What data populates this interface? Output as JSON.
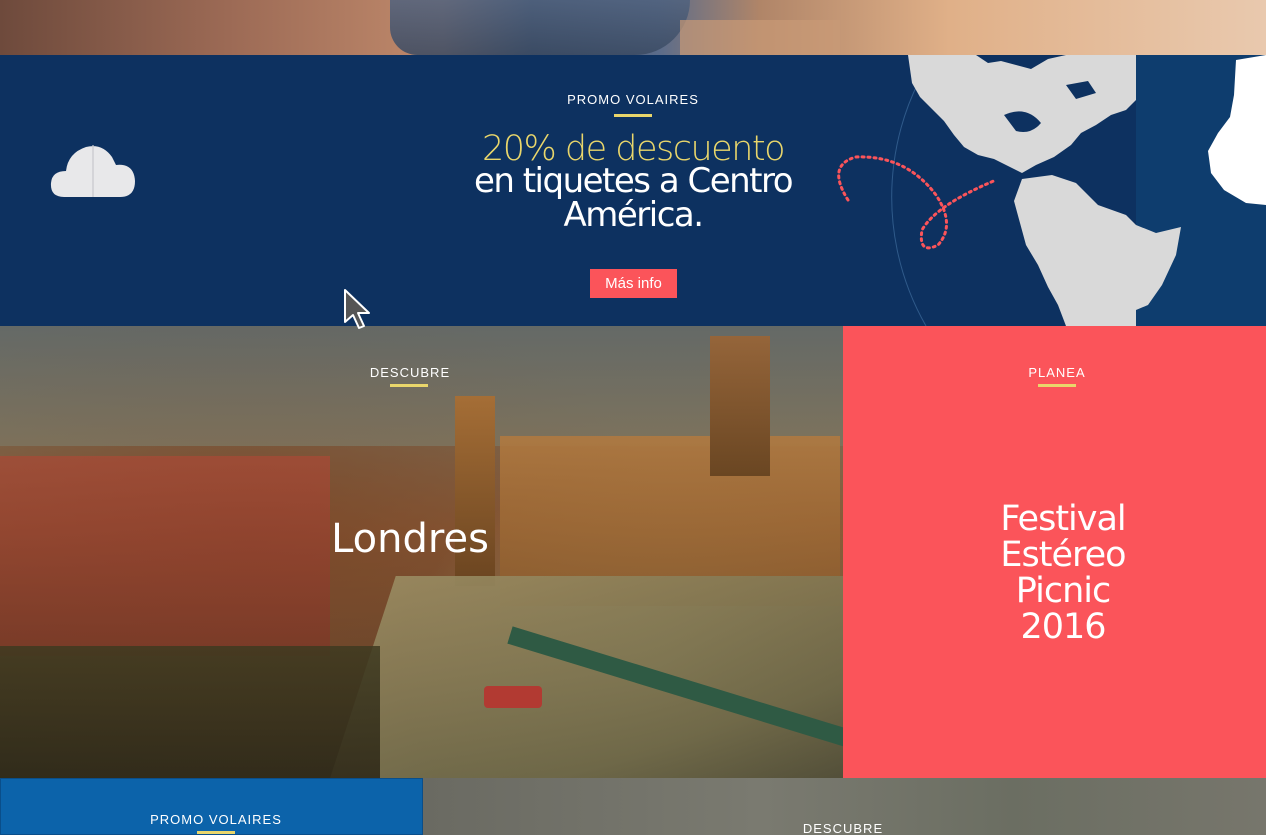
{
  "promo_banner": {
    "eyebrow": "PROMO VOLAIRES",
    "headline_highlight": "20% de descuento",
    "headline_line1": "en tiquetes a Centro",
    "headline_line2": "América.",
    "cta_label": "Más info",
    "icons": [
      "cloud-icon",
      "globe-map-icon"
    ],
    "colors": {
      "background": "#0d3160",
      "accent": "#e9d66b",
      "button": "#fb545a"
    }
  },
  "london_card": {
    "eyebrow": "DESCUBRE",
    "title": "Londres"
  },
  "festival_card": {
    "eyebrow": "PLANEA",
    "title_lines": [
      "Festival",
      "Estéreo",
      "Picnic",
      "2016"
    ],
    "colors": {
      "background": "#fb545a"
    }
  },
  "bottom_promo": {
    "eyebrow": "PROMO VOLAIRES",
    "colors": {
      "background": "#0c63aa"
    }
  },
  "bottom_discover": {
    "eyebrow": "DESCUBRE"
  }
}
